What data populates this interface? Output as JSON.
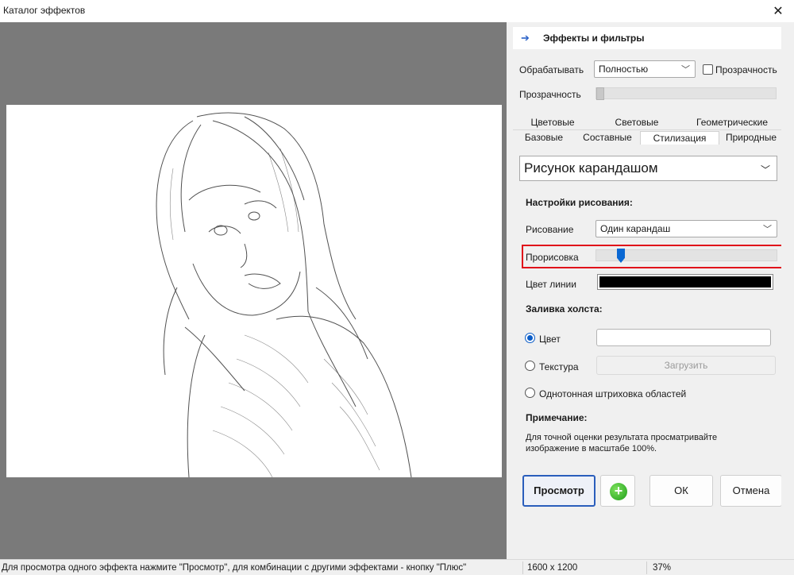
{
  "window": {
    "title": "Каталог эффектов"
  },
  "panel": {
    "header": "Эффекты и фильтры",
    "process_label": "Обрабатывать",
    "process_value": "Полностью",
    "transparency_check_label": "Прозрачность",
    "transparency_label": "Прозрачность",
    "tabs_row1": [
      "Цветовые",
      "Световые",
      "Геометрические"
    ],
    "tabs_row2": [
      "Базовые",
      "Составные",
      "Стилизация",
      "Природные"
    ],
    "active_tab": "Стилизация",
    "effect_value": "Рисунок карандашом",
    "draw_settings_title": "Настройки рисования:",
    "drawing_label": "Рисование",
    "drawing_value": "Один карандаш",
    "detail_label": "Прорисовка",
    "detail_level": 0.12,
    "line_color_label": "Цвет линии",
    "line_color": "#000000",
    "fill_title": "Заливка холста:",
    "radio_color": "Цвет",
    "radio_texture": "Текстура",
    "load_button": "Загрузить",
    "radio_hatch": "Однотонная штриховка областей",
    "note_title": "Примечание:",
    "note_line1": "Для точной оценки результата просматривайте",
    "note_line2": "изображение в масштабе 100%."
  },
  "buttons": {
    "preview": "Просмотр",
    "ok": "ОК",
    "cancel": "Отмена"
  },
  "status": {
    "hint": "Для просмотра одного эффекта нажмите \"Просмотр\", для комбинации с другими эффектами - кнопку \"Плюс\"",
    "dimensions": "1600 x 1200",
    "zoom": "37%"
  },
  "colors": {
    "accent": "#0a68d3",
    "highlight": "#e0101a",
    "preview_bg": "#7a7a7a"
  }
}
